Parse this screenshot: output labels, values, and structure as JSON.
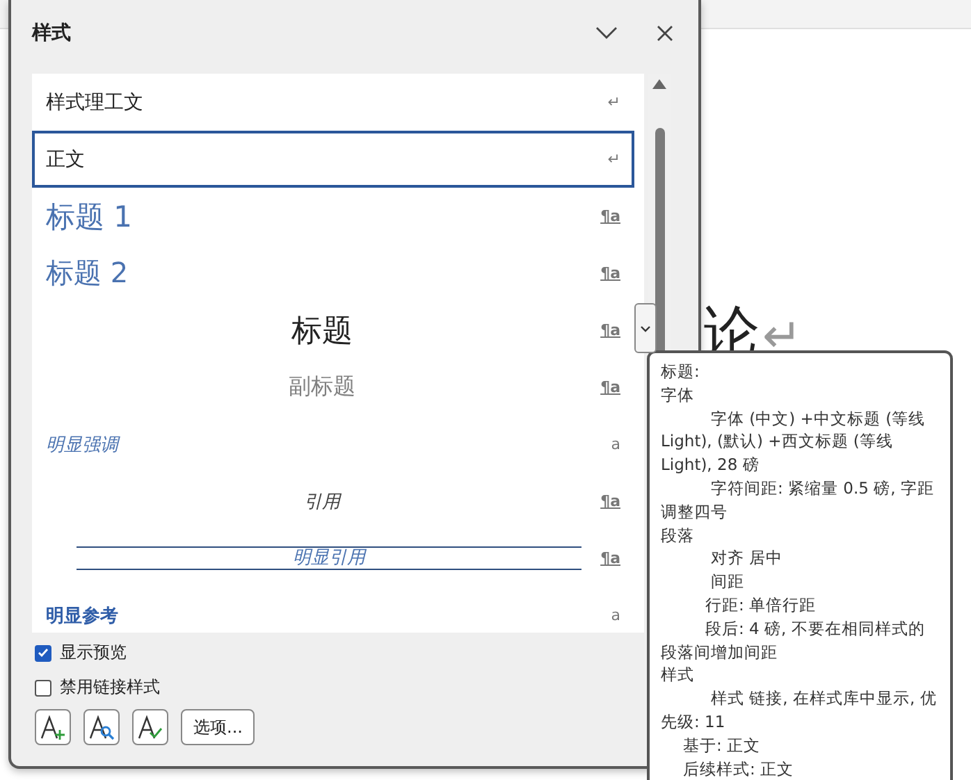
{
  "document": {
    "heading": "论",
    "heading_mark": "↵"
  },
  "panel": {
    "title": "样式",
    "styles": [
      {
        "name": "样式理工文",
        "kind": "plain",
        "marker": "↵",
        "selected": false,
        "menu_button": false
      },
      {
        "name": "正文",
        "kind": "plain",
        "marker": "↵",
        "selected": true,
        "menu_button": false
      },
      {
        "name": "标题 1",
        "kind": "heading1",
        "marker": "¶a",
        "selected": false,
        "menu_button": false
      },
      {
        "name": "标题 2",
        "kind": "heading2",
        "marker": "¶a",
        "selected": false,
        "menu_button": false
      },
      {
        "name": "标题",
        "kind": "title",
        "marker": "¶a",
        "selected": false,
        "menu_button": true
      },
      {
        "name": "副标题",
        "kind": "subtitle",
        "marker": "¶a",
        "selected": false,
        "menu_button": false
      },
      {
        "name": "明显强调",
        "kind": "emphasis",
        "marker": "a",
        "selected": false,
        "menu_button": false
      },
      {
        "name": "引用",
        "kind": "quote",
        "marker": "¶a",
        "selected": false,
        "menu_button": false
      },
      {
        "name": "明显引用",
        "kind": "intense_quote",
        "marker": "¶a",
        "selected": false,
        "menu_button": false
      },
      {
        "name": "明显参考",
        "kind": "reference",
        "marker": "a",
        "selected": false,
        "menu_button": false
      }
    ],
    "options": [
      {
        "label": "显示预览",
        "checked": true
      },
      {
        "label": "禁用链接样式",
        "checked": false
      }
    ],
    "tool_buttons": [
      {
        "kind": "new"
      },
      {
        "kind": "inspect"
      },
      {
        "kind": "manage"
      }
    ],
    "options_button": "选项..."
  },
  "tooltip": [
    {
      "text": "标题:",
      "kind": "section"
    },
    {
      "text": "字体",
      "kind": "section"
    },
    {
      "text": "字体 (中文) +中文标题 (等线 Light), (默认) +西文标题 (等线 Light), 28 磅",
      "kind": "detail"
    },
    {
      "text": "字符间距:  紧缩量  0.5 磅, 字距调整四号",
      "kind": "detail"
    },
    {
      "text": "段落",
      "kind": "section"
    },
    {
      "text": "对齐 居中",
      "kind": "detail"
    },
    {
      "text": "间距",
      "kind": "detail"
    },
    {
      "text": "行距: 单倍行距",
      "kind": "spacing"
    },
    {
      "text": "段后: 4 磅, 不要在相同样式的段落间增加间距",
      "kind": "spacing"
    },
    {
      "text": "样式",
      "kind": "section"
    },
    {
      "text": "样式 链接, 在样式库中显示, 优先级: 11",
      "kind": "detail"
    },
    {
      "text": "基于: 正文",
      "kind": "relation"
    },
    {
      "text": "后续样式: 正文",
      "kind": "relation"
    }
  ]
}
